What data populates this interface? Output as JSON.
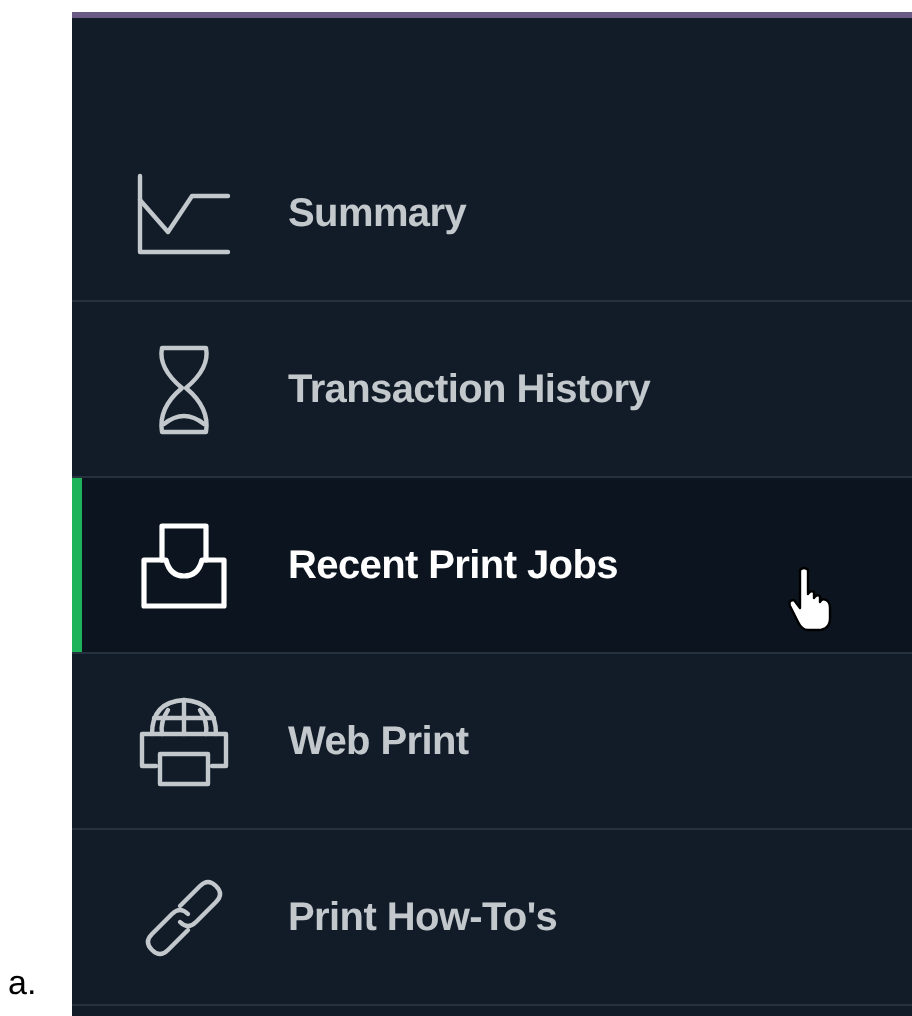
{
  "figure_label": "a.",
  "sidebar": {
    "items": [
      {
        "kind": "chart",
        "label": "Summary",
        "selected": false
      },
      {
        "kind": "hourglass",
        "label": "Transaction History",
        "selected": false
      },
      {
        "kind": "inbox",
        "label": "Recent Print Jobs",
        "selected": true,
        "hovered": true
      },
      {
        "kind": "webprint",
        "label": "Web Print",
        "selected": false
      },
      {
        "kind": "link",
        "label": "Print How-To's",
        "selected": false
      }
    ]
  }
}
